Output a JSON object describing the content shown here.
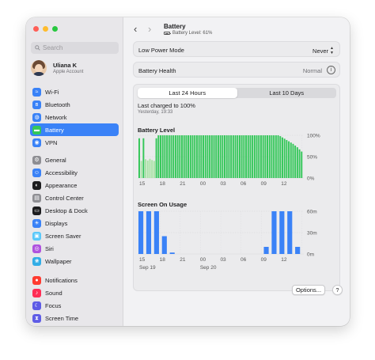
{
  "sidebar": {
    "search_placeholder": "Search",
    "account": {
      "name": "Uliana K",
      "subtitle": "Apple Account"
    },
    "groups": [
      {
        "items": [
          {
            "label": "Wi-Fi",
            "icon": "wifi-icon",
            "color": "#3a82f7",
            "glyph": "≈"
          },
          {
            "label": "Bluetooth",
            "icon": "bluetooth-icon",
            "color": "#3a82f7",
            "glyph": "ʙ"
          },
          {
            "label": "Network",
            "icon": "globe-icon",
            "color": "#3a82f7",
            "glyph": "◍"
          },
          {
            "label": "Battery",
            "icon": "battery-icon",
            "color": "#34c759",
            "glyph": "▬",
            "selected": true
          },
          {
            "label": "VPN",
            "icon": "vpn-icon",
            "color": "#3a82f7",
            "glyph": "◉"
          }
        ]
      },
      {
        "items": [
          {
            "label": "General",
            "icon": "gear-icon",
            "color": "#8e8e93",
            "glyph": "⚙"
          },
          {
            "label": "Accessibility",
            "icon": "accessibility-icon",
            "color": "#3a82f7",
            "glyph": "☺"
          },
          {
            "label": "Appearance",
            "icon": "appearance-icon",
            "color": "#1d1d1f",
            "glyph": "◐"
          },
          {
            "label": "Control Center",
            "icon": "control-center-icon",
            "color": "#8e8e93",
            "glyph": "▤"
          },
          {
            "label": "Desktop & Dock",
            "icon": "dock-icon",
            "color": "#1d1d1f",
            "glyph": "▭"
          },
          {
            "label": "Displays",
            "icon": "displays-icon",
            "color": "#3a82f7",
            "glyph": "☀"
          },
          {
            "label": "Screen Saver",
            "icon": "screen-saver-icon",
            "color": "#5ac8fa",
            "glyph": "▣"
          },
          {
            "label": "Siri",
            "icon": "siri-icon",
            "color": "#af52de",
            "glyph": "◎"
          },
          {
            "label": "Wallpaper",
            "icon": "wallpaper-icon",
            "color": "#32ade6",
            "glyph": "❀"
          }
        ]
      },
      {
        "items": [
          {
            "label": "Notifications",
            "icon": "notifications-icon",
            "color": "#ff3b30",
            "glyph": "●"
          },
          {
            "label": "Sound",
            "icon": "sound-icon",
            "color": "#ff2d55",
            "glyph": "♪"
          },
          {
            "label": "Focus",
            "icon": "focus-icon",
            "color": "#5e5ce6",
            "glyph": "☾"
          },
          {
            "label": "Screen Time",
            "icon": "screen-time-icon",
            "color": "#5e5ce6",
            "glyph": "⧗"
          }
        ]
      }
    ]
  },
  "header": {
    "title": "Battery",
    "subtitle": "Battery Level: 61%"
  },
  "low_power": {
    "label": "Low Power Mode",
    "value": "Never"
  },
  "battery_health": {
    "label": "Battery Health",
    "value": "Normal"
  },
  "tabs": [
    {
      "label": "Last 24 Hours",
      "active": true
    },
    {
      "label": "Last 10 Days",
      "active": false
    }
  ],
  "last_charged": {
    "text": "Last charged to 100%",
    "time": "Yesterday, 19:33"
  },
  "colors": {
    "accent": "#3a82f7",
    "battery_bar": "#34c759",
    "battery_bar_light": "#a8e3a4",
    "usage_bar": "#3a82f7"
  },
  "chart_data": [
    {
      "type": "bar",
      "title": "Battery Level",
      "x_tick_labels": [
        "15",
        "18",
        "21",
        "00",
        "03",
        "06",
        "09",
        "12"
      ],
      "y_tick_labels": [
        "100%",
        "50%",
        "0%"
      ],
      "ylim": [
        0,
        100
      ],
      "values": [
        93,
        40,
        93,
        44,
        41,
        45,
        42,
        40,
        93,
        100,
        100,
        100,
        100,
        100,
        100,
        100,
        100,
        100,
        100,
        100,
        100,
        100,
        100,
        100,
        100,
        100,
        100,
        100,
        100,
        100,
        100,
        100,
        100,
        100,
        100,
        100,
        100,
        100,
        100,
        100,
        100,
        100,
        100,
        100,
        100,
        100,
        100,
        100,
        100,
        100,
        100,
        100,
        100,
        100,
        100,
        100,
        100,
        100,
        100,
        100,
        100,
        100,
        100,
        100,
        100,
        100,
        98,
        95,
        92,
        89,
        86,
        83,
        80,
        76,
        72,
        67,
        62
      ],
      "grid": true
    },
    {
      "type": "bar",
      "title": "Screen On Usage",
      "x_tick_labels": [
        "15",
        "18",
        "21",
        "00",
        "03",
        "06",
        "09",
        "12"
      ],
      "y_tick_labels": [
        "60m",
        "30m",
        "0m"
      ],
      "ylim": [
        0,
        60
      ],
      "values": [
        60,
        60,
        60,
        25,
        2,
        0,
        0,
        0,
        0,
        0,
        0,
        0,
        0,
        0,
        0,
        0,
        10,
        60,
        60,
        60,
        10
      ],
      "day_labels": [
        "Sep 19",
        "Sep 20"
      ],
      "grid": true
    }
  ],
  "footer": {
    "options_label": "Options...",
    "help_label": "?"
  }
}
